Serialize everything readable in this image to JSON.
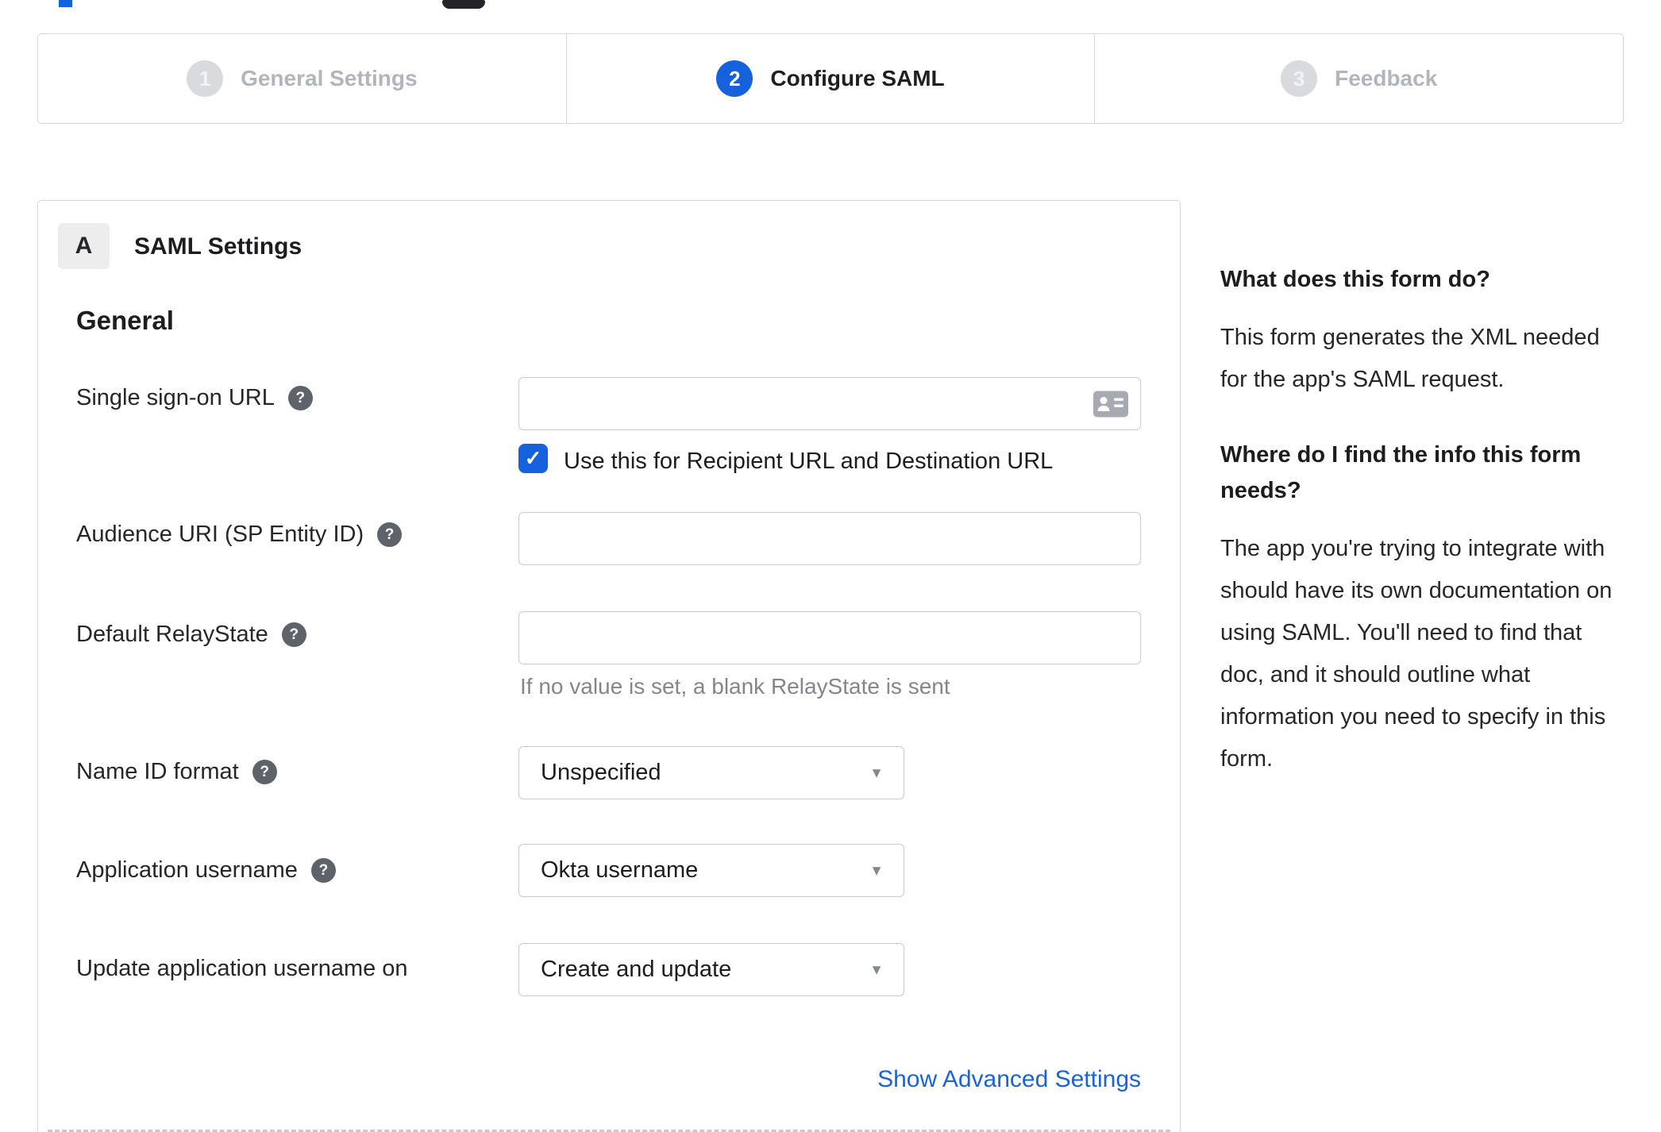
{
  "stepper": {
    "steps": [
      {
        "number": "1",
        "label": "General Settings",
        "state": "inactive"
      },
      {
        "number": "2",
        "label": "Configure SAML",
        "state": "active"
      },
      {
        "number": "3",
        "label": "Feedback",
        "state": "inactive"
      }
    ]
  },
  "panel": {
    "badge": "A",
    "title": "SAML Settings",
    "heading": "General"
  },
  "form": {
    "sso_url": {
      "label": "Single sign-on URL",
      "value": "",
      "checkbox": {
        "label": "Use this for Recipient URL and Destination URL",
        "checked": true
      }
    },
    "audience_uri": {
      "label": "Audience URI (SP Entity ID)",
      "value": ""
    },
    "default_relaystate": {
      "label": "Default RelayState",
      "value": "",
      "helper": "If no value is set, a blank RelayState is sent"
    },
    "name_id_format": {
      "label": "Name ID format",
      "value": "Unspecified"
    },
    "app_username": {
      "label": "Application username",
      "value": "Okta username"
    },
    "update_app_username": {
      "label": "Update application username on",
      "value": "Create and update"
    },
    "advanced_link": "Show Advanced Settings"
  },
  "sidebar": {
    "heading1": "What does this form do?",
    "body1": "This form generates the XML needed for the app's SAML request.",
    "heading2": "Where do I find the info this form needs?",
    "body2": "The app you're trying to integrate with should have its own documentation on using SAML. You'll need to find that doc, and it should outline what information you need to specify in this form."
  },
  "icons": {
    "help": "?",
    "checkmark": "✓",
    "dropdown_caret": "▼"
  },
  "colors": {
    "accent_blue": "#1662dd",
    "link_blue": "#1a63da",
    "inactive_gray": "#d8dade",
    "border_gray": "#d5d7d9",
    "text_dark": "#1d1d21",
    "muted_text": "#83878d"
  }
}
